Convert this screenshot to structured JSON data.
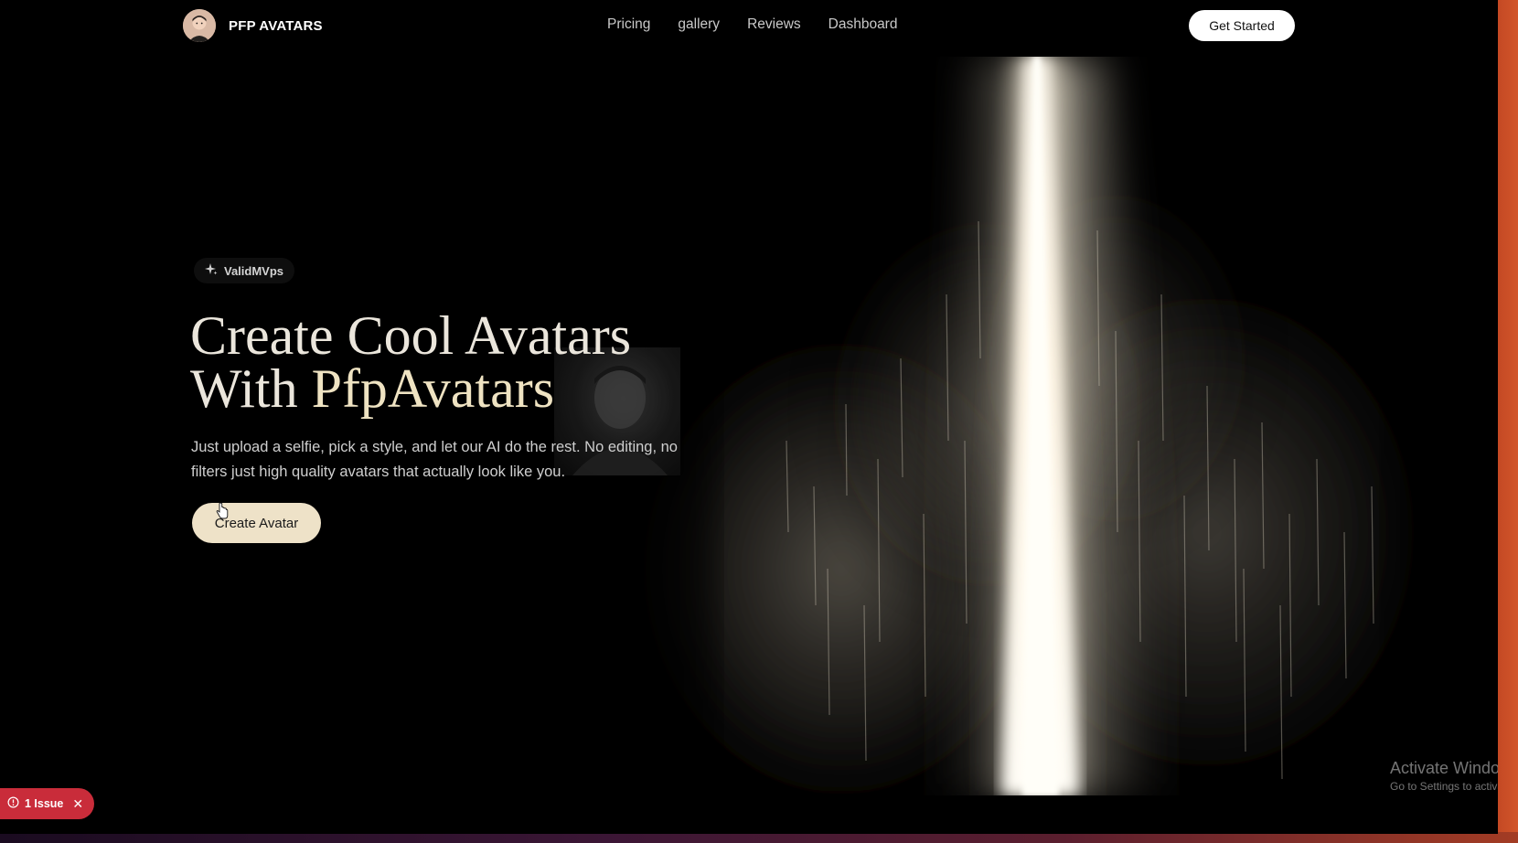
{
  "brand": {
    "name": "PFP AVATARS",
    "logo_icon": "avatar-logo-icon"
  },
  "nav": {
    "links": [
      {
        "label": "Pricing"
      },
      {
        "label": "gallery"
      },
      {
        "label": "Reviews"
      },
      {
        "label": "Dashboard"
      }
    ],
    "cta_label": "Get Started"
  },
  "hero": {
    "badge": {
      "label": "ValidMVps",
      "icon": "sparkle-icon"
    },
    "headline_line1": "Create Cool Avatars",
    "headline_line2_prefix": "With ",
    "headline_line2_accent": "PfpAvatars",
    "subtext": "Just upload a selfie, pick a style, and let our AI do the rest. No editing, no filters just high quality avatars that actually look like you.",
    "cta_label": "Create Avatar"
  },
  "dev_overlay": {
    "issues_label": "1 Issue",
    "icon": "alert-circle-icon",
    "close_icon": "close-icon"
  },
  "os_watermark": {
    "title": "Activate Windows",
    "subtitle": "Go to Settings to activate Windows."
  },
  "colors": {
    "background": "#000000",
    "accent_cream": "#eee2c8",
    "issue_red": "#c92c3a",
    "desktop_orange": "#d2552a"
  }
}
